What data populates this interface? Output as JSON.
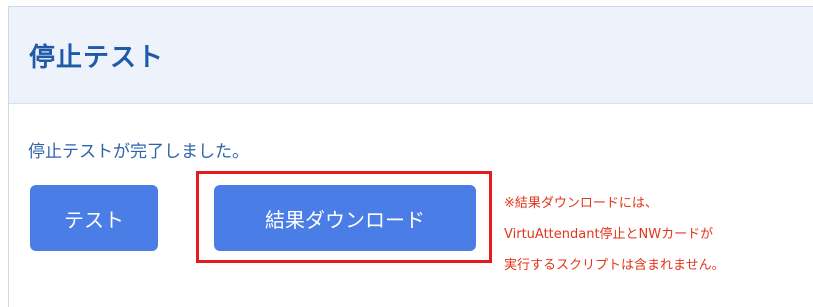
{
  "panel": {
    "title": "停止テスト",
    "status": "停止テストが完了しました。"
  },
  "buttons": {
    "test_label": "テスト",
    "download_label": "結果ダウンロード"
  },
  "note": {
    "lines": [
      "※結果ダウンロードには、",
      "VirtuAttendant停止とNWカードが",
      "実行するスクリプトは含まれません。"
    ]
  },
  "colors": {
    "title": "#1f5aa8",
    "button": "#4a7ee6",
    "highlight": "#e31b1b",
    "note": "#e2361a"
  }
}
